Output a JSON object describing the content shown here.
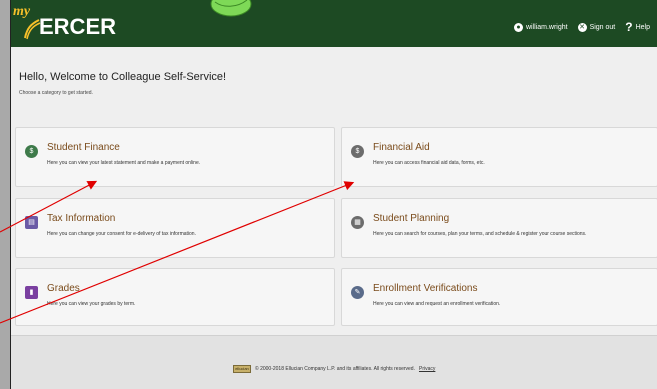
{
  "header": {
    "logo_my": "my",
    "logo_word": "ERCER",
    "username": "william.wright",
    "signout_label": "Sign out",
    "help_label": "Help"
  },
  "welcome": {
    "title": "Hello, Welcome to Colleague Self-Service!",
    "subtitle": "Choose a category to get started."
  },
  "cards": [
    {
      "title": "Student Finance",
      "desc": "Here you can view your latest statement and make a payment online.",
      "icon": "dollar-icon"
    },
    {
      "title": "Financial Aid",
      "desc": "Here you can access financial aid data, forms, etc.",
      "icon": "money-icon"
    },
    {
      "title": "Tax Information",
      "desc": "Here you can change your consent for e-delivery of tax information.",
      "icon": "tax-doc-icon"
    },
    {
      "title": "Student Planning",
      "desc": "Here you can search for courses, plan your terms, and schedule & register your course sections.",
      "icon": "planning-icon"
    },
    {
      "title": "Grades",
      "desc": "Here you can view your grades by term.",
      "icon": "grades-icon"
    },
    {
      "title": "Enrollment Verifications",
      "desc": "Here you can view and request an enrollment verification.",
      "icon": "verification-icon"
    }
  ],
  "footer": {
    "badge": "ellucian",
    "copyright": "© 2000-2018 Ellucian Company L.P. and its affiliates. All rights reserved.",
    "privacy_label": "Privacy"
  },
  "colors": {
    "header_bg": "#1d4a23",
    "card_title": "#7a4b1b",
    "arrow": "#e00000"
  }
}
